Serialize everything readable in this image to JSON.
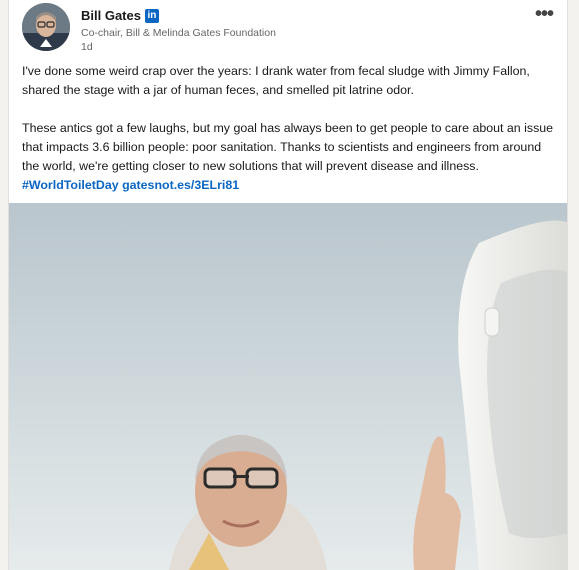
{
  "author": {
    "name": "Bill Gates",
    "network_badge": "in",
    "title": "Co-chair, Bill & Melinda Gates Foundation",
    "posted_ago": "1d",
    "icons": {
      "avatar": "avatar-photo",
      "badge": "linkedin-icon",
      "menu": "more-options-icon"
    }
  },
  "menu": {
    "label": "•••"
  },
  "post": {
    "paragraph1": "I've done some weird crap over the years: I drank water from fecal sludge with Jimmy Fallon, shared the stage with a jar of human feces, and smelled pit latrine odor.",
    "paragraph2": "These antics got a few laughs, but my goal has always been to get people to care about an issue that impacts 3.6 billion people: poor sanitation. Thanks to scientists and engineers from around the world, we're getting closer to new solutions that will prevent disease and illness.",
    "hashtag": "#WorldToiletDay",
    "link": "gatesnot.es/3ELri81"
  },
  "colors": {
    "link": "#0a66c2",
    "badge": "#0a66c2"
  }
}
